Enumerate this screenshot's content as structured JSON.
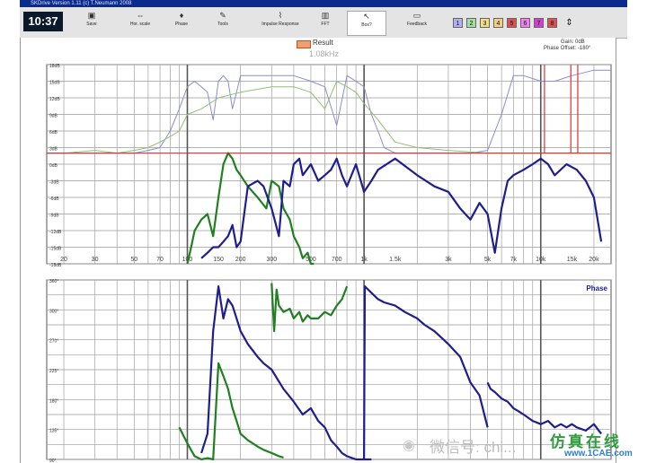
{
  "window": {
    "title": "SKDrive Version 1.11 (c) T.Neumann 2008"
  },
  "toolbar": {
    "clock": "10:37",
    "buttons": [
      {
        "label": "Save",
        "icon": "floppy-icon"
      },
      {
        "label": "Hor. scale",
        "icon": "horizontal-scale-icon"
      },
      {
        "label": "Phase",
        "icon": "phase-icon"
      },
      {
        "label": "Tools",
        "icon": "tools-icon"
      },
      {
        "label": "Impulse Response",
        "icon": "impulse-response-icon"
      },
      {
        "label": "FFT",
        "icon": "fft-icon"
      },
      {
        "label": "Box?",
        "icon": "cursor-icon"
      },
      {
        "label": "Feedback",
        "icon": "feedback-icon"
      }
    ],
    "channels": [
      {
        "label": "1",
        "color": "#b0b0f0"
      },
      {
        "label": "2",
        "color": "#a0e0a0"
      },
      {
        "label": "3",
        "color": "#f0e080"
      },
      {
        "label": "4",
        "color": "#f0d080"
      },
      {
        "label": "5",
        "color": "#e05050"
      },
      {
        "label": "6",
        "color": "#f080f0"
      },
      {
        "label": "7",
        "color": "#d040d0"
      },
      {
        "label": "8",
        "color": "#e05050"
      }
    ],
    "menu_glyph": "⇕"
  },
  "legend": {
    "label": "Result",
    "freq": "1.08kHz"
  },
  "gain": "Gain: 0dB",
  "phase_offset": "Phase Offset: -180°",
  "magnitude": {
    "y_ticks": [
      "18dB",
      "15dB",
      "12dB",
      "9dB",
      "6dB",
      "3dB",
      "0dB",
      "-3dB",
      "-6dB",
      "-9dB",
      "-12dB",
      "-15dB",
      "-18dB"
    ],
    "x_ticks": [
      "20",
      "30",
      "50",
      "70",
      "100",
      "150",
      "200",
      "300",
      "500",
      "700",
      "1k",
      "1.5k",
      "3k",
      "5k",
      "7k",
      "10k",
      "15k",
      "20k"
    ]
  },
  "phase": {
    "label": "Phase",
    "y_ticks": [
      "360°",
      "300°",
      "270°",
      "225°",
      "180°",
      "135°",
      "90°"
    ]
  },
  "watermark": {
    "left": "微信号: chi...",
    "brand": "仿真在线",
    "url": "www.1CAE.com"
  },
  "chart_data": [
    {
      "type": "line",
      "ylabel": "",
      "x_scale": "log",
      "xlim": [
        16,
        25000
      ],
      "ylim": [
        -18,
        18
      ],
      "series": [
        {
          "color": "#8c8cd0",
          "x": [
            16,
            20,
            30,
            40,
            50,
            60,
            70,
            80,
            90,
            100,
            110,
            120,
            130,
            140,
            150,
            160,
            170,
            180,
            200,
            250,
            300,
            400,
            500,
            600,
            700,
            800,
            900,
            1000,
            1100,
            1200,
            1300,
            1500,
            2000,
            3000,
            4000,
            5000,
            6000,
            7000,
            8000,
            10000,
            12000,
            15000,
            20000,
            25000
          ],
          "y": [
            2,
            2,
            2,
            2,
            2,
            2.5,
            3,
            6,
            10,
            14,
            15,
            14,
            13,
            8,
            15,
            16,
            15,
            10,
            16,
            16,
            16,
            16,
            15,
            14,
            7,
            16,
            15,
            14,
            9,
            6,
            3,
            2,
            2,
            2,
            2,
            2.5,
            9,
            16,
            16,
            15,
            15,
            16,
            17,
            17
          ]
        },
        {
          "color": "#90c070",
          "x": [
            16,
            20,
            30,
            40,
            50,
            60,
            70,
            80,
            90,
            100,
            120,
            150,
            200,
            300,
            400,
            500,
            600,
            700,
            800,
            900,
            1000,
            1200,
            1500,
            2000,
            3000,
            5000,
            7000,
            10000,
            15000,
            20000,
            25000
          ],
          "y": [
            2,
            2,
            2.5,
            2,
            2.5,
            3,
            4,
            5,
            6,
            9,
            10,
            12,
            13,
            14,
            14,
            13,
            10,
            15,
            14,
            13,
            11,
            8,
            4,
            3,
            2.5,
            2,
            2,
            2,
            2,
            2,
            2
          ]
        },
        {
          "color": "#208020",
          "x": [
            100,
            105,
            110,
            120,
            130,
            140,
            150,
            160,
            170,
            180,
            190,
            200,
            220,
            250,
            280,
            300,
            330,
            350,
            380,
            400,
            430,
            450,
            480,
            500,
            520
          ],
          "y": [
            -18,
            -15,
            -12,
            -10,
            -9,
            -13,
            -6,
            0,
            2,
            1,
            -1,
            -2,
            -4,
            -6,
            -8,
            -3,
            -4,
            -8,
            -10,
            -13,
            -15,
            -17,
            -16,
            -18,
            -18
          ]
        },
        {
          "color": "#1e1e8c",
          "x": [
            120,
            130,
            140,
            150,
            160,
            170,
            180,
            190,
            200,
            220,
            250,
            270,
            300,
            330,
            350,
            380,
            400,
            430,
            450,
            500,
            550,
            600,
            650,
            700,
            750,
            800,
            900,
            1000,
            1100,
            1200,
            1500,
            2000,
            2500,
            3000,
            3500,
            4000,
            4500,
            5000,
            5500,
            6000,
            6500,
            7000,
            8000,
            9000,
            10000,
            11000,
            12000,
            14000,
            16000,
            18000,
            20000,
            22000
          ],
          "y": [
            -17,
            -16,
            -15,
            -15,
            -14,
            -13,
            -11,
            -15,
            -14,
            -4,
            -3,
            -4,
            -8,
            -13,
            -3,
            -4,
            0,
            1,
            -2,
            0,
            -3,
            -2,
            -1,
            1,
            -2,
            -4,
            0,
            -5,
            -3,
            -1,
            1,
            -2,
            -4,
            -5,
            -8,
            -10,
            -7,
            -9,
            -16,
            -8,
            -3,
            -2,
            -1,
            0,
            1,
            0,
            -2,
            0,
            -1,
            -3,
            -6,
            -14
          ]
        }
      ]
    },
    {
      "type": "line",
      "ylabel": "",
      "x_scale": "log",
      "xlim": [
        16,
        25000
      ],
      "ylim": [
        80,
        360
      ],
      "series": [
        {
          "color": "#208020",
          "x": [
            90,
            100,
            110,
            120,
            130,
            140,
            150,
            160,
            170,
            180,
            190,
            200,
            220,
            250,
            270,
            300,
            330,
            350
          ],
          "y": [
            130,
            105,
            85,
            80,
            82,
            80,
            230,
            210,
            190,
            160,
            140,
            120,
            110,
            100,
            95,
            90,
            85,
            83
          ]
        },
        {
          "color": "#208020",
          "x": [
            300,
            310,
            320,
            330,
            350,
            380,
            400,
            430,
            450,
            480,
            500,
            550,
            600,
            650,
            700,
            750,
            800
          ],
          "y": [
            355,
            280,
            345,
            320,
            310,
            315,
            300,
            310,
            295,
            305,
            300,
            300,
            310,
            305,
            320,
            330,
            350
          ]
        },
        {
          "color": "#1e1e8c",
          "x": [
            120,
            130,
            140,
            150,
            160,
            170,
            180,
            190,
            200,
            220,
            250,
            270,
            300,
            350,
            400,
            450,
            500,
            550,
            600,
            650,
            700,
            750,
            800,
            900,
            1000,
            1100
          ],
          "y": [
            90,
            120,
            280,
            350,
            300,
            330,
            320,
            300,
            280,
            260,
            240,
            230,
            220,
            190,
            170,
            150,
            160,
            140,
            130,
            110,
            100,
            90,
            85,
            80,
            80,
            80
          ]
        },
        {
          "color": "#1e1e8c",
          "x": [
            1000,
            1010,
            1100,
            1200,
            1300,
            1500,
            1700,
            2000,
            2200,
            2500,
            3000,
            3500,
            4000,
            4500,
            5000
          ],
          "y": [
            80,
            350,
            340,
            330,
            325,
            320,
            310,
            300,
            290,
            280,
            260,
            240,
            200,
            180,
            130
          ]
        },
        {
          "color": "#1e1e8c",
          "x": [
            5000,
            5200,
            5500,
            6000,
            6500,
            7000,
            7500,
            8000,
            8500,
            9000,
            10000,
            11000,
            12000,
            13000,
            14000,
            15000,
            16000,
            18000,
            20000,
            22000
          ],
          "y": [
            200,
            190,
            185,
            175,
            170,
            160,
            155,
            150,
            145,
            140,
            135,
            140,
            130,
            135,
            130,
            135,
            130,
            125,
            135,
            120
          ]
        }
      ]
    }
  ]
}
